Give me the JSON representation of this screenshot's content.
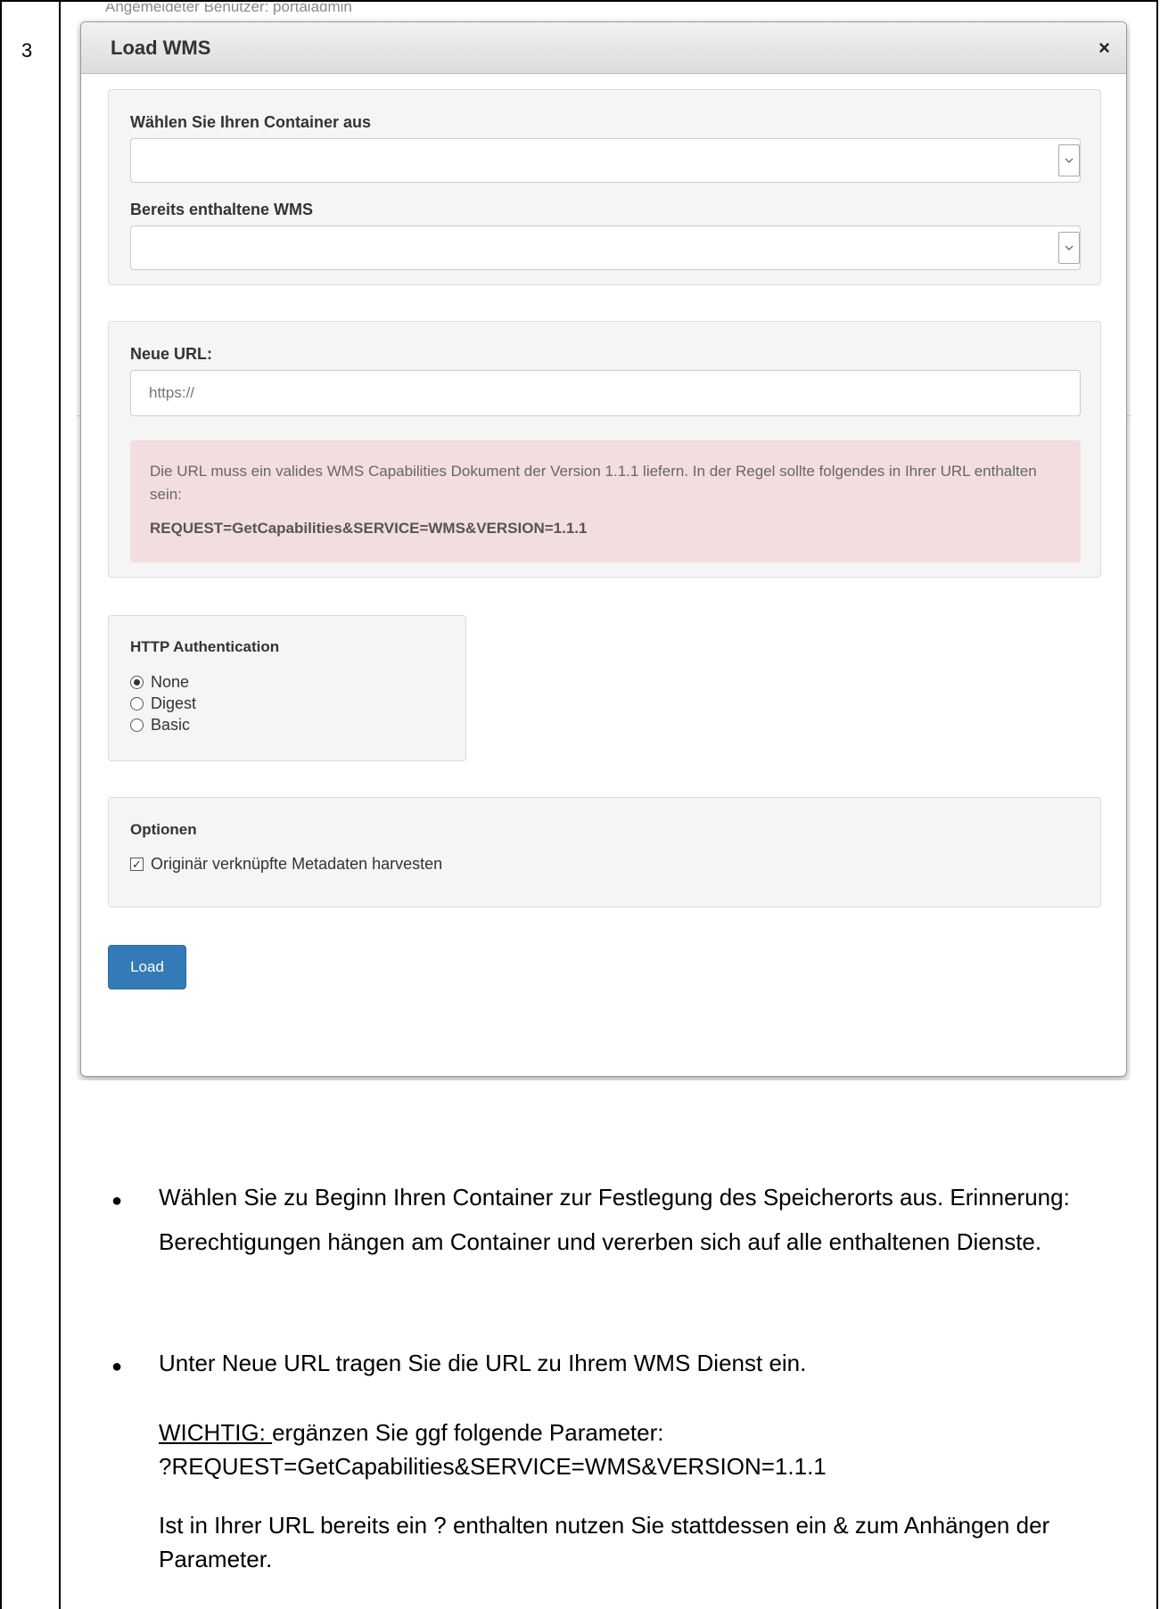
{
  "row_number": "3",
  "background_text": "Angemeldeter Benutzer: portaladmin",
  "modal": {
    "title": "Load WMS",
    "close_symbol": "×",
    "container_label": "Wählen Sie Ihren Container aus",
    "container_value": "",
    "existing_label": "Bereits enthaltene WMS",
    "existing_value": "",
    "new_url_label": "Neue URL:",
    "new_url_placeholder": "https://",
    "alert_text": "Die URL muss ein valides WMS Capabilities Dokument der Version 1.1.1 liefern. In der Regel sollte folgendes in Ihrer URL enthalten sein:",
    "alert_param": "REQUEST=GetCapabilities&SERVICE=WMS&VERSION=1.1.1",
    "auth_label": "HTTP Authentication",
    "auth_options": [
      {
        "label": "None",
        "checked": true
      },
      {
        "label": "Digest",
        "checked": false
      },
      {
        "label": "Basic",
        "checked": false
      }
    ],
    "options_label": "Optionen",
    "options_checkbox": "Originär verknüpfte Metadaten harvesten",
    "options_checked": true,
    "load_button": "Load"
  },
  "instructions": {
    "bullet1": "Wählen Sie zu Beginn Ihren Container zur Festlegung des Speicherorts aus. Erinnerung: Berechtigungen hängen am Container und vererben sich auf alle enthaltenen Dienste.",
    "bullet2": "Unter Neue URL tragen Sie die URL zu Ihrem WMS Dienst ein.",
    "important_prefix": "WICHTIG: ",
    "important_text": "ergänzen Sie ggf folgende Parameter:",
    "param": "?REQUEST=GetCapabilities&SERVICE=WMS&VERSION=1.1.1",
    "note": "Ist in Ihrer URL bereits ein ? enthalten nutzen Sie stattdessen ein & zum Anhängen der Parameter."
  }
}
